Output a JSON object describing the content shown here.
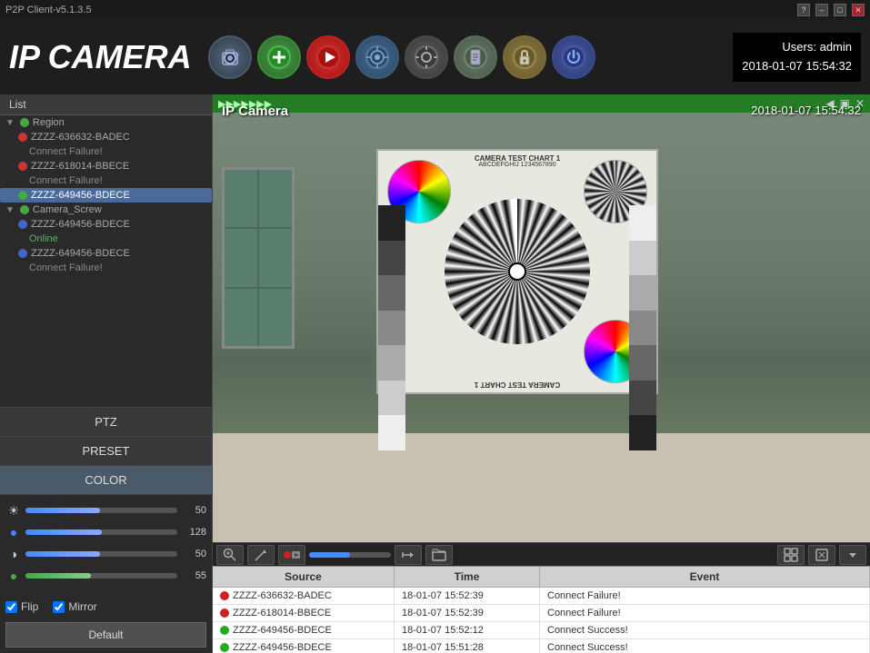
{
  "titlebar": {
    "title": "P2P Client-v5.1.3.5",
    "help_btn": "?",
    "min_btn": "–",
    "max_btn": "□",
    "close_btn": "✕"
  },
  "header": {
    "app_title": "IP CAMERA",
    "datetime_users": "Users: admin",
    "datetime": "2018-01-07  15:54:32"
  },
  "toolbar": {
    "buttons": [
      {
        "id": "camera",
        "label": "📷",
        "class": "tb-camera"
      },
      {
        "id": "add",
        "label": "➕",
        "class": "tb-add"
      },
      {
        "id": "play",
        "label": "▶",
        "class": "tb-play"
      },
      {
        "id": "ptz",
        "label": "🎯",
        "class": "tb-ptz"
      },
      {
        "id": "settings",
        "label": "⚙",
        "class": "tb-settings"
      },
      {
        "id": "file",
        "label": "📄",
        "class": "tb-file"
      },
      {
        "id": "lock",
        "label": "🔒",
        "class": "tb-lock"
      },
      {
        "id": "power",
        "label": "⏻",
        "class": "tb-power"
      }
    ]
  },
  "sidebar": {
    "list_label": "List",
    "tree_items": [
      {
        "id": "group1",
        "label": "Region",
        "type": "group",
        "dot": "green"
      },
      {
        "id": "item1",
        "label": "ZZZZ-636632-BADEC",
        "type": "child",
        "dot": "red"
      },
      {
        "id": "item2",
        "label": "Connect Failure!",
        "type": "subchild"
      },
      {
        "id": "item3",
        "label": "ZZZZ-618014-BBECE",
        "type": "child",
        "dot": "red"
      },
      {
        "id": "item4",
        "label": "Connect Failure!",
        "type": "subchild"
      },
      {
        "id": "item5",
        "label": "ZZZZ-649456-BDECE",
        "type": "child-selected"
      },
      {
        "id": "group2",
        "label": "Camera_Screw",
        "type": "group",
        "dot": "green"
      },
      {
        "id": "item6",
        "label": "ZZZZ-649456-BDECE",
        "type": "child",
        "dot": "blue"
      },
      {
        "id": "item7",
        "label": "Online",
        "type": "subchild"
      },
      {
        "id": "item8",
        "label": "ZZZZ-649456-BDECE",
        "type": "child",
        "dot": "blue"
      },
      {
        "id": "item9",
        "label": "Connect Failure!",
        "type": "subchild"
      }
    ],
    "ptz_label": "PTZ",
    "preset_label": "PRESET",
    "color_label": "COLOR",
    "sliders": [
      {
        "icon": "☀",
        "value": 50,
        "fill_pct": 49,
        "label": "50"
      },
      {
        "icon": "🔵",
        "value": 128,
        "fill_pct": 50,
        "label": "128"
      },
      {
        "icon": "◐",
        "value": 50,
        "fill_pct": 49,
        "label": "50"
      },
      {
        "icon": "🟢",
        "value": 55,
        "fill_pct": 43,
        "label": "55"
      }
    ],
    "flip_label": "Flip",
    "mirror_label": "Mirror",
    "default_btn": "Default"
  },
  "camera_view": {
    "cam_label": "IP Camera",
    "cam_datetime": "2018-01-07  15:54:32",
    "status_bar_text": "",
    "toolbar_buttons": [
      {
        "id": "zoom",
        "label": "🔍"
      },
      {
        "id": "pen",
        "label": "✏"
      },
      {
        "id": "record",
        "label": "⏺"
      },
      {
        "id": "snapshot",
        "label": "📷"
      },
      {
        "id": "arrow",
        "label": "➡"
      },
      {
        "id": "folder",
        "label": "📁"
      }
    ],
    "toolbar_right_buttons": [
      {
        "id": "grid",
        "label": "⊞"
      },
      {
        "id": "fullscreen",
        "label": "⛶"
      },
      {
        "id": "expand",
        "label": "⌄"
      }
    ]
  },
  "event_log": {
    "columns": [
      "Source",
      "Time",
      "Event"
    ],
    "rows": [
      {
        "status": "red",
        "source": "ZZZZ-636632-BADEC",
        "time": "18-01-07 15:52:39",
        "event": "Connect Failure!"
      },
      {
        "status": "red",
        "source": "ZZZZ-618014-BBECE",
        "time": "18-01-07 15:52:39",
        "event": "Connect Failure!"
      },
      {
        "status": "green",
        "source": "ZZZZ-649456-BDECE",
        "time": "18-01-07 15:52:12",
        "event": "Connect Success!"
      },
      {
        "status": "green",
        "source": "ZZZZ-649456-BDECE",
        "time": "18-01-07 15:51:28",
        "event": "Connect Success!"
      }
    ]
  },
  "colors": {
    "accent": "#4a8aff",
    "bg_dark": "#1e1e1e",
    "bg_mid": "#2a2a2a",
    "status_red": "#cc2222",
    "status_green": "#22aa22"
  }
}
